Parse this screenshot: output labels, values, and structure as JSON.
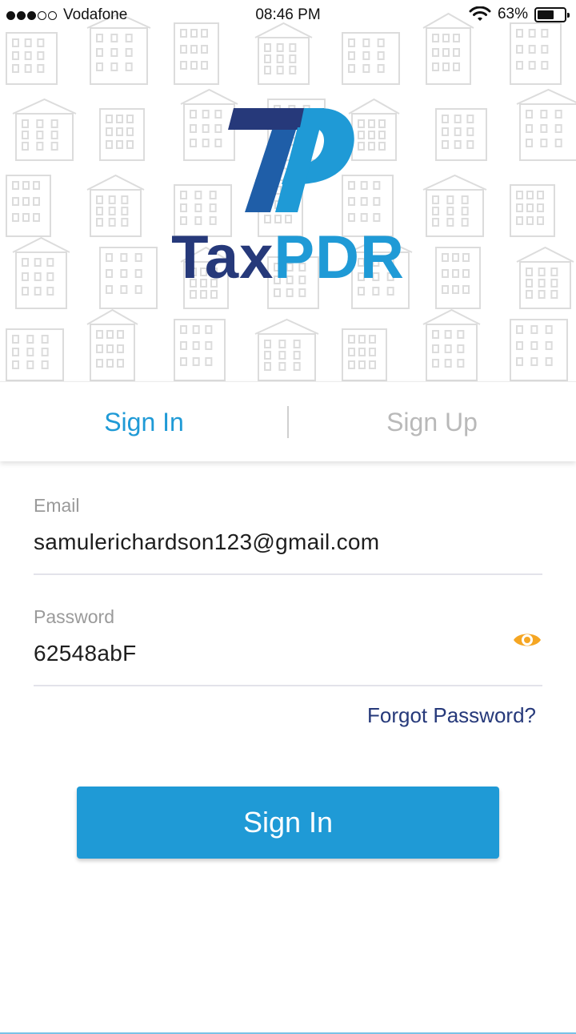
{
  "status_bar": {
    "carrier": "Vodafone",
    "time": "08:46 PM",
    "battery": "63%",
    "battery_level": 0.63,
    "signal_bars_filled": 3,
    "signal_bars_total": 5,
    "icons": [
      "signal-icon",
      "wifi-icon",
      "battery-icon"
    ]
  },
  "brand": {
    "name_part1": "Tax",
    "name_part2": "PDR",
    "colors": {
      "dark": "#26397a",
      "light": "#1f9ad6"
    }
  },
  "tabs": [
    {
      "label": "Sign In",
      "active": true
    },
    {
      "label": "Sign Up",
      "active": false
    }
  ],
  "form": {
    "email": {
      "label": "Email",
      "value": "samulerichardson123@gmail.com"
    },
    "password": {
      "label": "Password",
      "value": "62548abF",
      "toggle_icon": "eye-icon",
      "toggle_color": "#f5a623"
    },
    "forgot_password": "Forgot Password?",
    "submit_label": "Sign In"
  },
  "colors": {
    "accent": "#1f9ad6",
    "navy": "#26397a",
    "muted": "#9a9a9a"
  }
}
